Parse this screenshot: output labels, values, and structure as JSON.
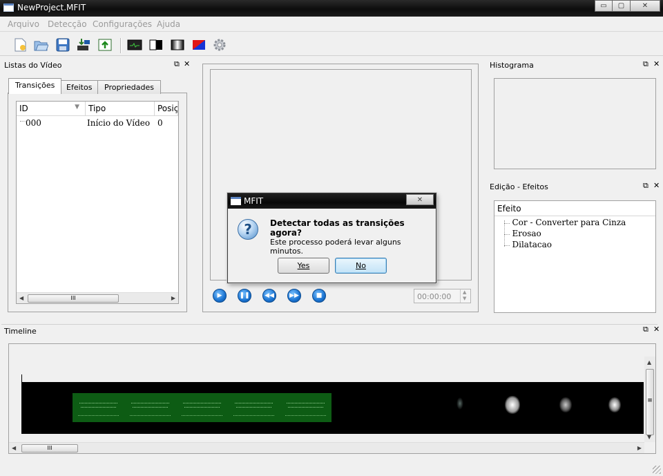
{
  "window": {
    "title": "NewProject.MFIT",
    "minimize": "▭",
    "maximize": "▢",
    "close": "✕"
  },
  "menu": [
    "Arquivo",
    "Detecção",
    "Configurações",
    "Ajuda"
  ],
  "toolbar": {
    "icons": [
      "new-file-icon",
      "open-folder-icon",
      "save-disk-icon",
      "import-video-icon",
      "export-icon",
      "monitor-icon",
      "bw-contrast-icon",
      "gradient-icon",
      "color-swap-icon",
      "gear-icon"
    ]
  },
  "video_list": {
    "title": "Listas do Vídeo",
    "tabs": [
      "Transições",
      "Efeitos",
      "Propriedades"
    ],
    "columns": [
      "ID",
      "Tipo",
      "Posiç"
    ],
    "rows": [
      {
        "id": "000",
        "tipo": "Início do Vídeo",
        "pos": "0"
      }
    ],
    "scroll_grip": "III"
  },
  "player": {
    "time": "00:00:00",
    "controls": [
      "play-icon",
      "pause-icon",
      "rewind-icon",
      "fast-forward-icon",
      "stop-icon"
    ]
  },
  "histogram": {
    "title": "Histograma"
  },
  "effects_edit": {
    "title": "Edição - Efeitos",
    "column": "Efeito",
    "items": [
      "Cor - Converter para Cinza",
      "Erosao",
      "Dilatacao"
    ]
  },
  "timeline": {
    "title": "Timeline",
    "scroll_grip": "III",
    "vscroll_grip": "≡"
  },
  "dialog": {
    "title": "MFIT",
    "close": "✕",
    "question": "Detectar todas as transições agora?",
    "message": "Este processo poderá levar alguns minutos.",
    "yes": "Yes",
    "no": "No",
    "icon_glyph": "?"
  },
  "dock_controls": {
    "float": "⧉",
    "close": "✕"
  },
  "colors": {
    "title_bar": "#0d0d0d",
    "accent_blue": "#1a73d1",
    "timeline_green": "#0d5c14"
  }
}
